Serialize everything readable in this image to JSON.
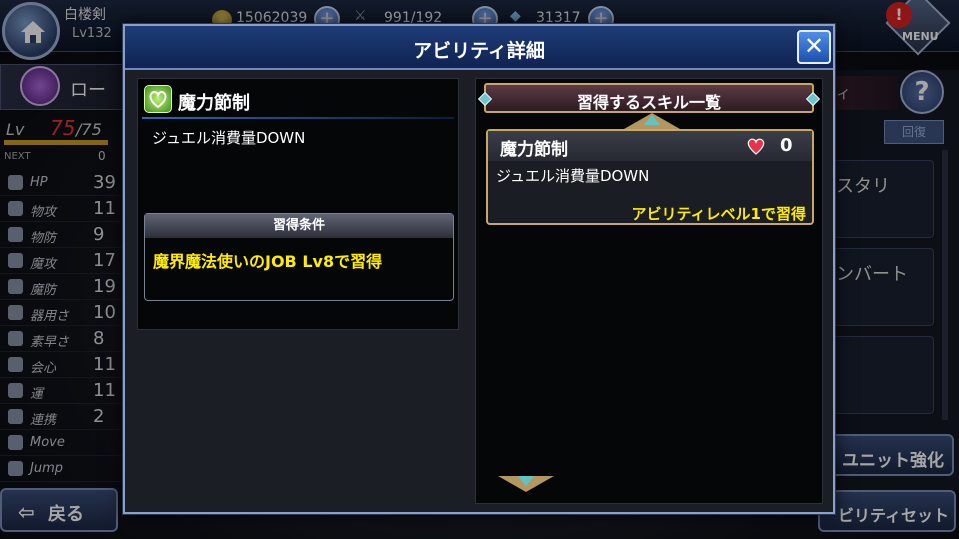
{
  "player": {
    "name": "白楼剣",
    "level": "Lv132"
  },
  "resources": {
    "gold": "15062039",
    "ap": "991/192",
    "gems": "31317"
  },
  "menu": {
    "label": "MENU"
  },
  "unit": {
    "name_partial": "ロー"
  },
  "level": {
    "label": "Lv",
    "current": "75",
    "max": "/75",
    "next_label": "NEXT",
    "next_value": "0"
  },
  "stats": [
    {
      "label": "HP",
      "value": "39"
    },
    {
      "label": "物攻",
      "value": "11"
    },
    {
      "label": "物防",
      "value": "9"
    },
    {
      "label": "魔攻",
      "value": "17"
    },
    {
      "label": "魔防",
      "value": "19"
    },
    {
      "label": "器用さ",
      "value": "10"
    },
    {
      "label": "素早さ",
      "value": "8"
    },
    {
      "label": "会心",
      "value": "11"
    },
    {
      "label": "運",
      "value": "11"
    },
    {
      "label": "連携",
      "value": "2"
    },
    {
      "label": "Move",
      "value": ""
    },
    {
      "label": "Jump",
      "value": ""
    }
  ],
  "back_button": {
    "label": "戻る"
  },
  "right_panel": {
    "tab_label": "ィ",
    "small_button": "回復",
    "card_texts": [
      "スタリ",
      "ンバート"
    ],
    "unit_strength": "ユニット強化",
    "ability_set": "ビリティセット"
  },
  "modal": {
    "title": "アビリティ詳細",
    "close_label": "✕",
    "ability_name": "魔力節制",
    "ability_desc": "ジュエル消費量DOWN",
    "condition_header": "習得条件",
    "condition_text": "魔界魔法使いのJOB Lv8で習得",
    "skill_list_header": "習得するスキル一覧",
    "skills": [
      {
        "name": "魔力節制",
        "cost": "0",
        "desc": "ジュエル消費量DOWN",
        "requirement": "アビリティレベル1で習得"
      }
    ]
  },
  "colors": {
    "title_bar": "#1f3c78",
    "highlight": "#ffec00",
    "card_border": "#c9a865"
  }
}
